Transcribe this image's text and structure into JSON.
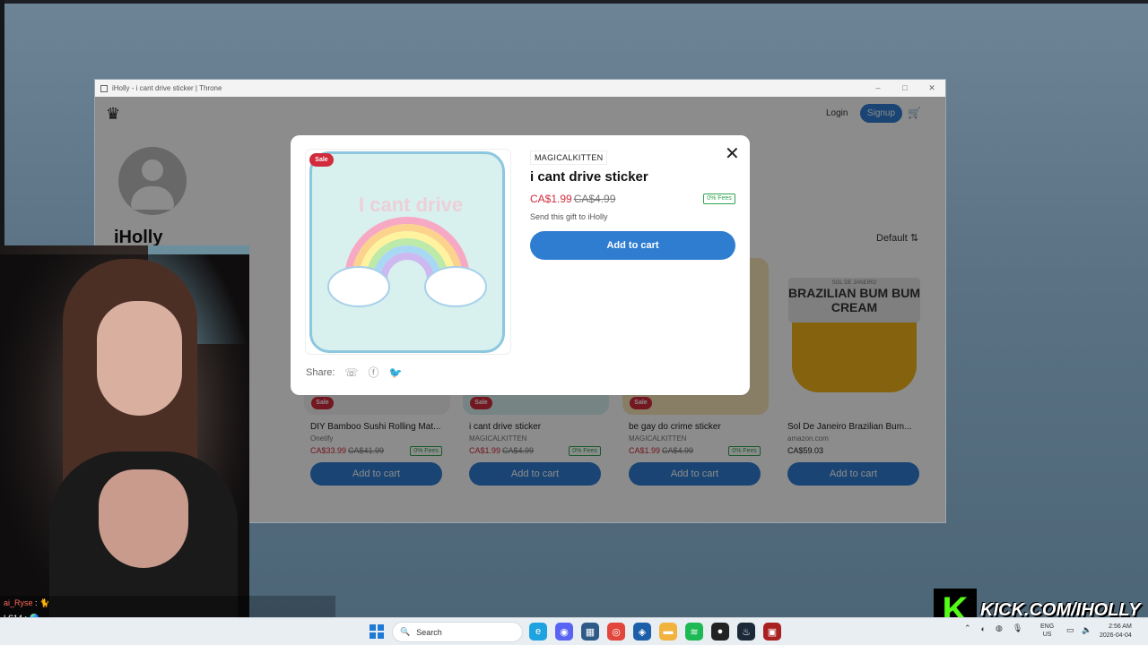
{
  "window": {
    "title": "iHolly - i cant drive sticker | Throne",
    "controls": [
      "–",
      "□",
      "✕"
    ]
  },
  "site": {
    "logo_icon": "crown-icon",
    "login": "Login",
    "signup": "Signup",
    "cart_icon": "cart-icon",
    "username": "iHolly",
    "sort": "Default ⇅"
  },
  "products": [
    {
      "badge": "Sale",
      "name": "DIY Bamboo Sushi Rolling Mat...",
      "seller": "Onetify",
      "price": "CA$33.99",
      "old_price": "CA$41.99",
      "fees": "0% Fees",
      "button": "Add to cart"
    },
    {
      "badge": "Sale",
      "name": "i cant drive sticker",
      "seller": "MAGICALKITTEN",
      "price": "CA$1.99",
      "old_price": "CA$4.99",
      "fees": "0% Fees",
      "button": "Add to cart"
    },
    {
      "badge": "Sale",
      "name": "be gay do crime sticker",
      "seller": "MAGICALKITTEN",
      "price": "CA$1.99",
      "old_price": "CA$4.99",
      "fees": "0% Fees",
      "button": "Add to cart"
    },
    {
      "badge": "",
      "name": "Sol De Janeiro Brazilian Bum...",
      "seller": "amazon.com",
      "price": "CA$59.03",
      "old_price": "",
      "fees": "",
      "button": "Add to cart"
    }
  ],
  "product_images": {
    "jar_label": "BRAZILIAN BUM BUM CREAM",
    "jar_brand": "SOL DE JANEIRO"
  },
  "modal": {
    "sale": "Sale",
    "sticker_text": "I cant drive",
    "seller": "MAGICALKITTEN",
    "title": "i cant drive sticker",
    "price": "CA$1.99",
    "old_price": "CA$4.99",
    "fees": "0% Fees",
    "gift_text": "Send this gift to iHolly",
    "add_button": "Add to cart",
    "share_label": "Share:",
    "close": "✕"
  },
  "chat": [
    {
      "user": "ai_Ryse",
      "sep": " : ",
      "msg": "🐈"
    },
    {
      "user": "LS14",
      "sep": " : ",
      "msg": "🌎"
    }
  ],
  "kick": {
    "logo": "K",
    "url": "KICK.COM/IHOLLY"
  },
  "taskbar": {
    "search": "Search",
    "lang_top": "ENG",
    "lang_bottom": "US",
    "time": "2:56 AM",
    "date": "2026-04-04"
  },
  "colors": {
    "accent": "#2f7dd1",
    "sale": "#d12b3d",
    "fees": "#2da44e",
    "kick": "#53fc18"
  }
}
